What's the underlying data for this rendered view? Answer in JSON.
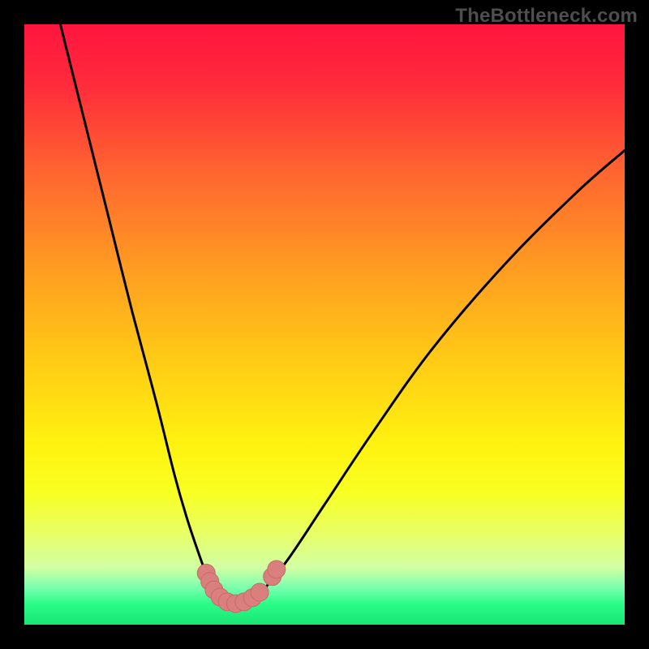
{
  "watermark": "TheBottleneck.com",
  "colors": {
    "frame": "#000000",
    "curve": "#000000",
    "marker_fill": "#d97f7d",
    "marker_stroke": "#c96a68",
    "gradient_stops": [
      {
        "offset": 0.0,
        "color": "#ff153f"
      },
      {
        "offset": 0.1,
        "color": "#ff2b3b"
      },
      {
        "offset": 0.25,
        "color": "#ff6630"
      },
      {
        "offset": 0.4,
        "color": "#ff9a22"
      },
      {
        "offset": 0.55,
        "color": "#ffc816"
      },
      {
        "offset": 0.7,
        "color": "#fff210"
      },
      {
        "offset": 0.78,
        "color": "#f8ff22"
      },
      {
        "offset": 0.85,
        "color": "#e7ff68"
      },
      {
        "offset": 0.905,
        "color": "#d1ffa4"
      },
      {
        "offset": 0.94,
        "color": "#76ffae"
      },
      {
        "offset": 0.965,
        "color": "#2bfc87"
      },
      {
        "offset": 1.0,
        "color": "#19e574"
      }
    ]
  },
  "chart_data": {
    "type": "line",
    "title": "",
    "xlabel": "",
    "ylabel": "",
    "xlim": [
      0,
      100
    ],
    "ylim": [
      0,
      100
    ],
    "grid": false,
    "legend": false,
    "series": [
      {
        "name": "bottleneck-curve",
        "x": [
          6,
          10,
          14,
          18,
          22,
          25,
          27,
          29,
          30.5,
          32,
          33,
          34,
          35,
          36,
          38,
          40,
          44,
          50,
          58,
          68,
          80,
          92,
          100
        ],
        "y": [
          100,
          84,
          68,
          52,
          37,
          25,
          18,
          12,
          8,
          5.5,
          4.3,
          3.7,
          3.4,
          3.5,
          4.2,
          6.0,
          11,
          20,
          32,
          46,
          60,
          72,
          79
        ]
      }
    ],
    "markers": {
      "name": "bottom-cluster",
      "points": [
        {
          "x": 30.3,
          "y": 8.6
        },
        {
          "x": 30.9,
          "y": 7.2
        },
        {
          "x": 31.6,
          "y": 5.8
        },
        {
          "x": 32.6,
          "y": 4.6
        },
        {
          "x": 33.8,
          "y": 3.8
        },
        {
          "x": 35.2,
          "y": 3.5
        },
        {
          "x": 36.6,
          "y": 3.8
        },
        {
          "x": 38.0,
          "y": 4.5
        },
        {
          "x": 39.2,
          "y": 5.4
        },
        {
          "x": 41.3,
          "y": 8.0
        },
        {
          "x": 42.0,
          "y": 9.2
        }
      ],
      "radius_px": 11
    }
  }
}
